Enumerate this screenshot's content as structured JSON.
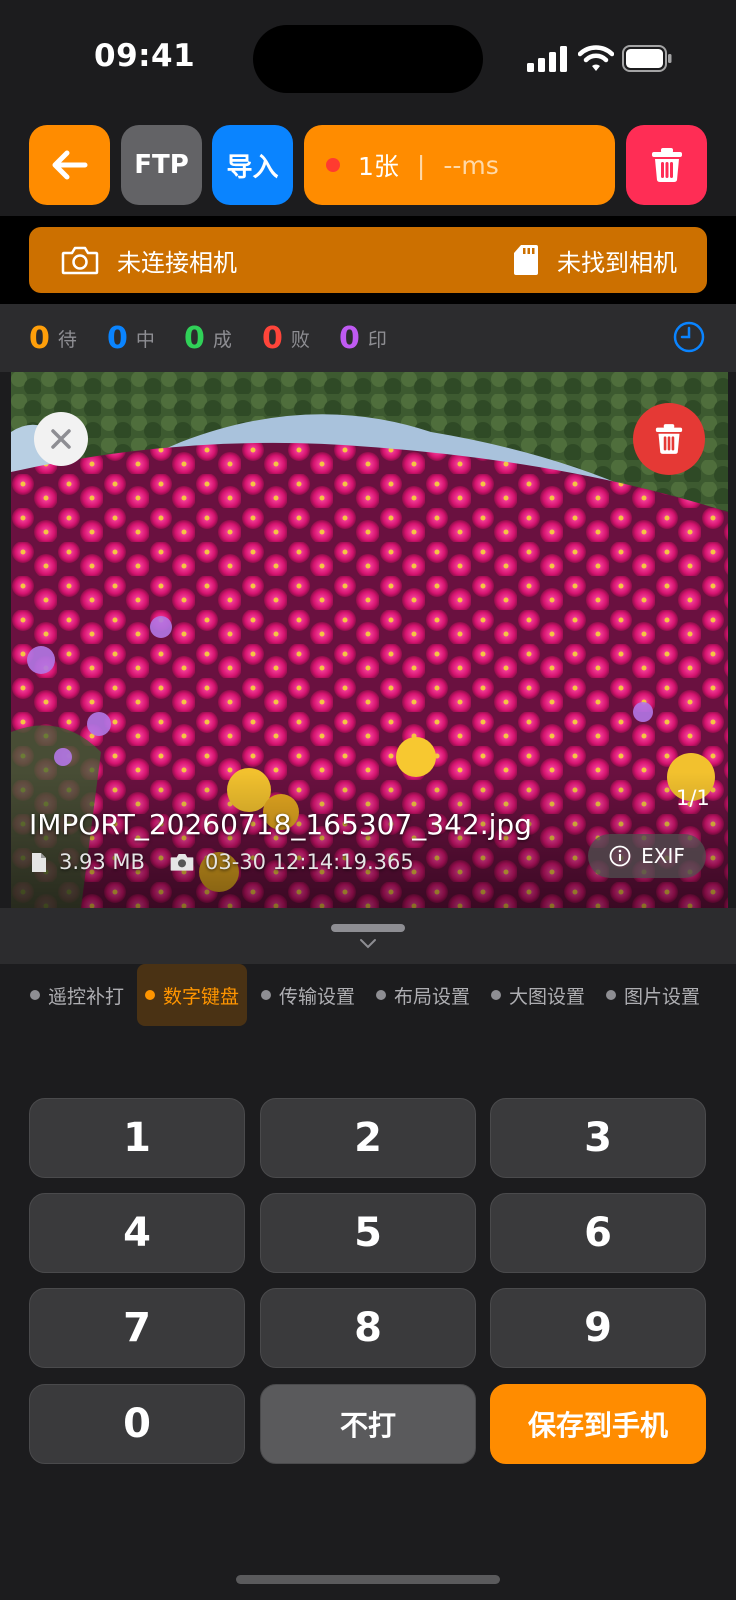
{
  "status_bar": {
    "time": "09:41"
  },
  "toolbar": {
    "ftp_label": "FTP",
    "import_label": "导入",
    "counter_count": "1张",
    "counter_sep": "|",
    "counter_ms": "--ms"
  },
  "camera_bar": {
    "left_label": "未连接相机",
    "right_label": "未找到相机"
  },
  "counts": [
    {
      "value": "0",
      "label": "待",
      "color": "#ff9f0a"
    },
    {
      "value": "0",
      "label": "中",
      "color": "#0a84ff"
    },
    {
      "value": "0",
      "label": "成",
      "color": "#30d158"
    },
    {
      "value": "0",
      "label": "败",
      "color": "#ff453a"
    },
    {
      "value": "0",
      "label": "印",
      "color": "#bf5af2"
    }
  ],
  "photo": {
    "page_indicator": "1/1",
    "filename": "IMPORT_20260718_165307_342.jpg",
    "size": "3.93 MB",
    "datetime": "03-30 12:14:19.365",
    "exif_label": "EXIF"
  },
  "tabs": [
    {
      "label": "遥控补打",
      "active": false
    },
    {
      "label": "数字键盘",
      "active": true
    },
    {
      "label": "传输设置",
      "active": false
    },
    {
      "label": "布局设置",
      "active": false
    },
    {
      "label": "大图设置",
      "active": false
    },
    {
      "label": "图片设置",
      "active": false
    }
  ],
  "keypad": {
    "keys": [
      "1",
      "2",
      "3",
      "4",
      "5",
      "6",
      "7",
      "8",
      "9",
      "0"
    ],
    "skip_label": "不打",
    "save_label": "保存到手机"
  },
  "colors": {
    "accent": "#ff8c00",
    "danger": "#ff2d55",
    "blue": "#0a84ff"
  }
}
